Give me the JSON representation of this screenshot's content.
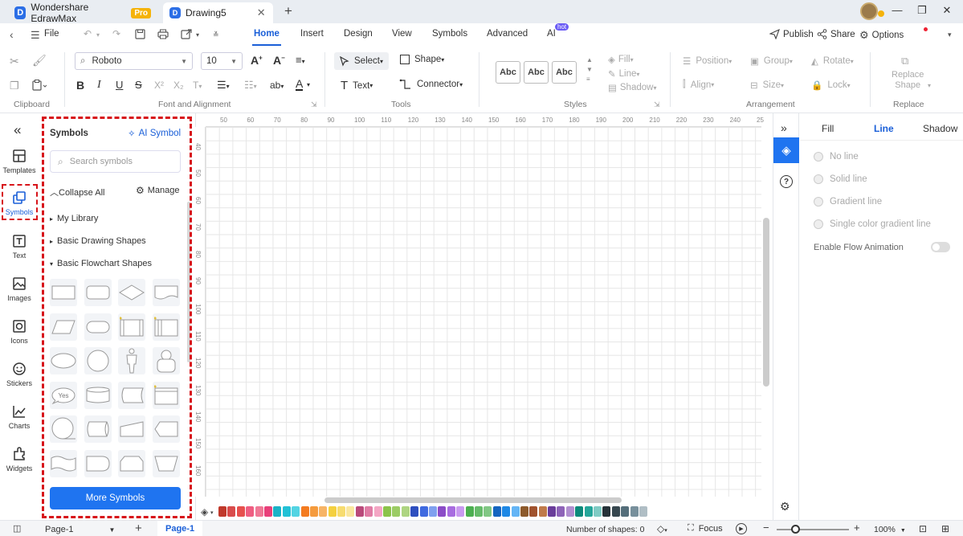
{
  "titlebar": {
    "tabs": [
      {
        "label": "Wondershare EdrawMax",
        "badge": "Pro"
      },
      {
        "label": "Drawing5"
      }
    ]
  },
  "menubar": {
    "file": "File",
    "tabs": [
      "Home",
      "Insert",
      "Design",
      "View",
      "Symbols",
      "Advanced",
      "AI"
    ],
    "ai_badge": "hot",
    "publish": "Publish",
    "share": "Share",
    "options": "Options"
  },
  "ribbon": {
    "font_name": "Roboto",
    "font_size": "10",
    "select": "Select",
    "shape": "Shape",
    "text": "Text",
    "connector": "Connector",
    "style_samples": [
      "Abc",
      "Abc",
      "Abc"
    ],
    "fill": "Fill",
    "line": "Line",
    "shadow": "Shadow",
    "position": "Position",
    "group": "Group",
    "rotate": "Rotate",
    "align": "Align",
    "size": "Size",
    "lock": "Lock",
    "replace_shape_1": "Replace",
    "replace_shape_2": "Shape",
    "groups": [
      "Clipboard",
      "Font and Alignment",
      "Tools",
      "Styles",
      "Arrangement",
      "Replace"
    ]
  },
  "rail": {
    "items": [
      "Templates",
      "Symbols",
      "Text",
      "Images",
      "Icons",
      "Stickers",
      "Charts",
      "Widgets"
    ]
  },
  "symbols": {
    "title": "Symbols",
    "ai_symbol": "AI Symbol",
    "search_placeholder": "Search symbols",
    "collapse_all": "Collapse All",
    "manage": "Manage",
    "categories": [
      "My Library",
      "Basic Drawing Shapes",
      "Basic Flowchart Shapes"
    ],
    "yes_label": "Yes",
    "more_symbols": "More Symbols"
  },
  "ruler": {
    "h": [
      "50",
      "60",
      "70",
      "80",
      "90",
      "100",
      "110",
      "120",
      "130",
      "140",
      "150",
      "160",
      "170",
      "180",
      "190",
      "200",
      "210",
      "220",
      "230",
      "240",
      "25"
    ],
    "v": [
      "40",
      "50",
      "60",
      "70",
      "80",
      "90",
      "100",
      "110",
      "120",
      "130",
      "140",
      "150",
      "160"
    ]
  },
  "rpanel": {
    "tabs": [
      "Fill",
      "Line",
      "Shadow"
    ],
    "options": [
      "No line",
      "Solid line",
      "Gradient line",
      "Single color gradient line"
    ],
    "flow_animation": "Enable Flow Animation"
  },
  "status": {
    "page_select": "Page-1",
    "page_tab": "Page-1",
    "shape_count": "Number of shapes: 0",
    "focus": "Focus",
    "zoom": "100%"
  },
  "colors": {
    "accent": "#1a5fd8",
    "highlight": "#d7141a",
    "button": "#1f74f0",
    "palette": [
      "#c0392b",
      "#d94c4c",
      "#e7504e",
      "#ef5e82",
      "#f07896",
      "#e9407a",
      "#1ab3c7",
      "#22c1d6",
      "#53d4e3",
      "#f47b20",
      "#f59b3d",
      "#f7b465",
      "#f4d03f",
      "#f7dc6f",
      "#f9e79f",
      "#b94a7a",
      "#e07ca5",
      "#f4a6c4",
      "#8bc34a",
      "#9ccc65",
      "#aed581",
      "#2e4fbf",
      "#3f6ae0",
      "#7fa0ef",
      "#8b4cc7",
      "#a86ce0",
      "#c99af0",
      "#4caf50",
      "#66bb6a",
      "#81c784",
      "#1565c0",
      "#1e88e5",
      "#64b5f6",
      "#8d5a2b",
      "#a0522d",
      "#c07a4a",
      "#6a3d9a",
      "#8e63b8",
      "#b18fd0",
      "#0d8a7b",
      "#26a69a",
      "#80cbc4",
      "#263238",
      "#37474f",
      "#546e7a",
      "#78909c",
      "#b0bec5"
    ]
  }
}
